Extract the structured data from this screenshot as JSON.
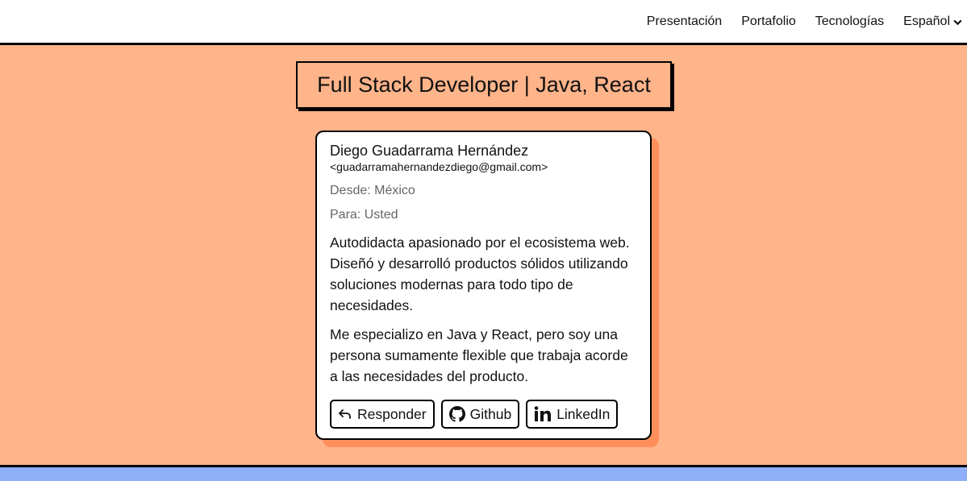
{
  "nav": {
    "links": [
      {
        "label": "Presentación"
      },
      {
        "label": "Portafolio"
      },
      {
        "label": "Tecnologías"
      }
    ],
    "language": {
      "selected": "Español"
    }
  },
  "hero": {
    "headline": "Full Stack Developer | Java, React"
  },
  "card": {
    "sender_name": "Diego Guadarrama Hernández",
    "sender_email": "<guadarramahernandezdiego@gmail.com>",
    "from": "Desde: México",
    "to": "Para: Usted",
    "paragraphs": [
      "Autodidacta apasionado por el ecosistema web. Diseñó y desarrolló productos sólidos utilizando soluciones modernas para todo tipo de necesidades.",
      "Me especializo en Java y React, pero soy una persona sumamente flexible que trabaja acorde a las necesidades del producto."
    ],
    "buttons": [
      {
        "label": "Responder",
        "icon": "reply-icon"
      },
      {
        "label": "Github",
        "icon": "github-icon"
      },
      {
        "label": "LinkedIn",
        "icon": "linkedin-icon"
      }
    ]
  },
  "colors": {
    "hero_background": "#ffb48a",
    "card_shadow": "#ff8f5a",
    "bottom_band": "#8eaef8"
  }
}
